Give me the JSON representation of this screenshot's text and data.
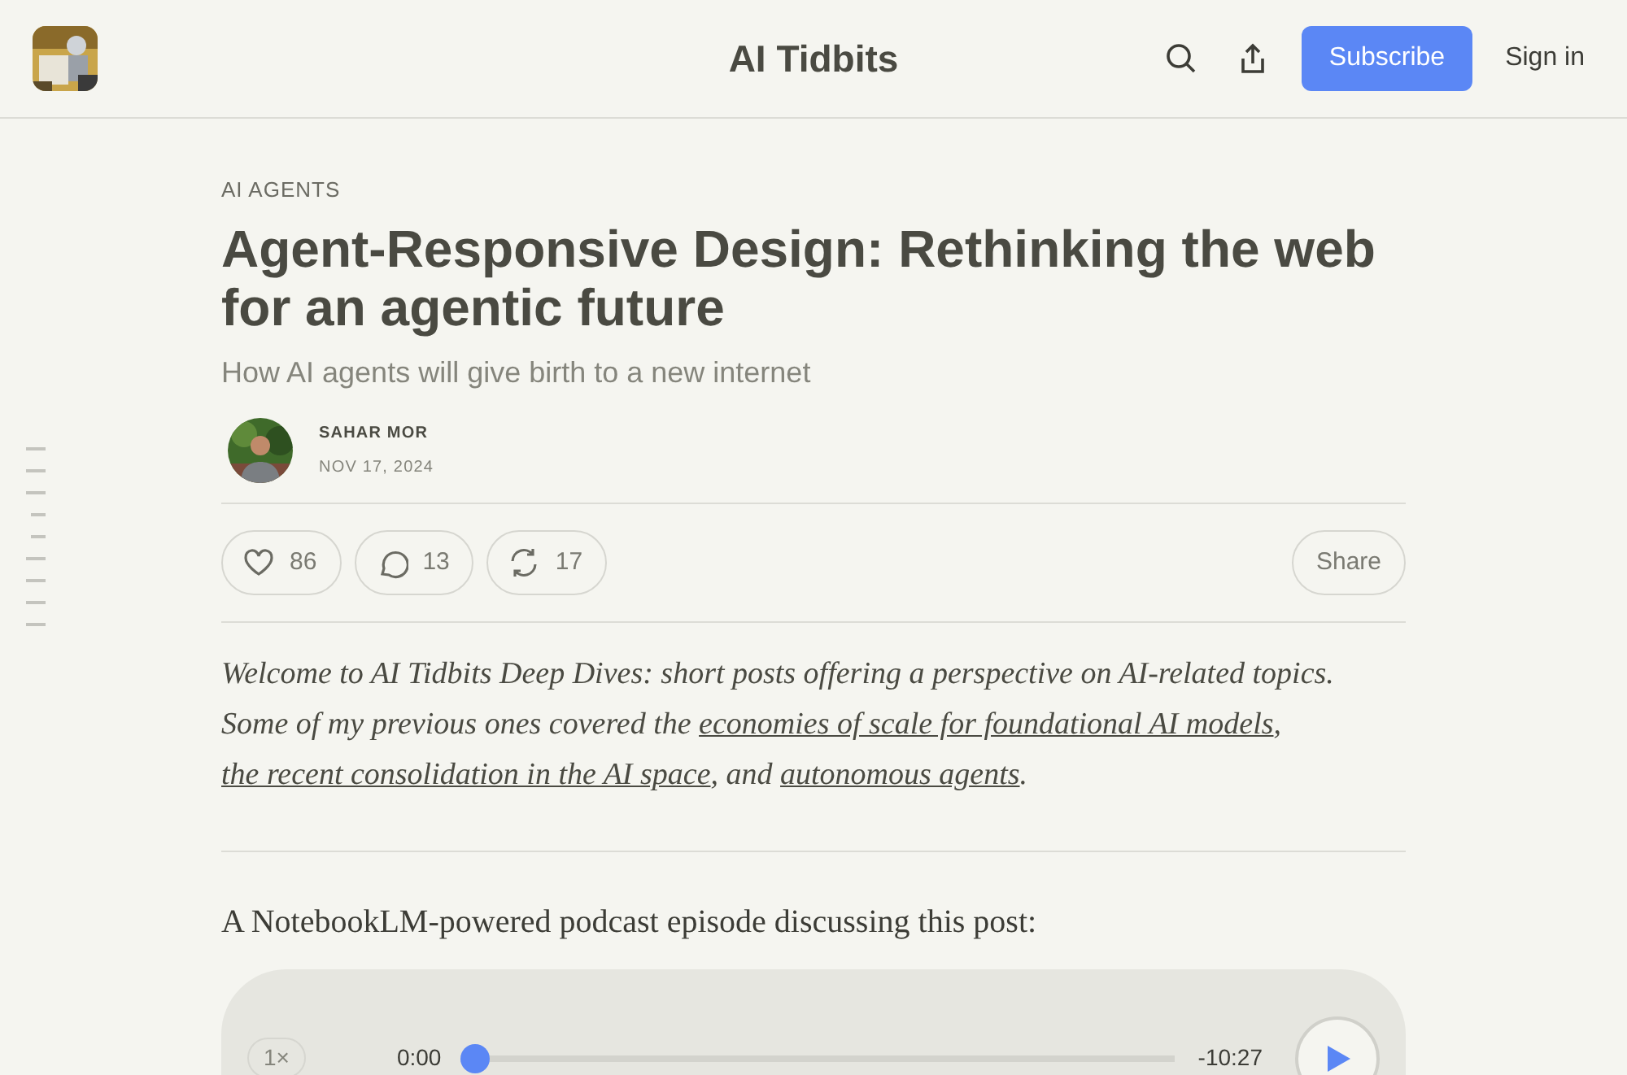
{
  "header": {
    "title": "AI Tidbits",
    "subscribe": "Subscribe",
    "sign_in": "Sign in"
  },
  "post": {
    "category": "AI AGENTS",
    "title": "Agent-Responsive Design: Rethinking the web for an agentic future",
    "subtitle": "How AI agents will give birth to a new internet",
    "author": "SAHAR MOR",
    "date": "NOV 17, 2024",
    "actions": [
      {
        "kind": "like",
        "count": "86"
      },
      {
        "kind": "comment",
        "count": "13"
      },
      {
        "kind": "restack",
        "count": "17"
      }
    ],
    "share": "Share",
    "intro": [
      {
        "text": "Welcome to AI Tidbits Deep Dives: short posts offering a perspective on AI-related topics. Some of my previous ones covered the ",
        "link": false
      },
      {
        "text": "economies of scale for foundational AI models",
        "link": true
      },
      {
        "text": ", ",
        "link": false
      },
      {
        "text": "the recent consolidation in the AI space",
        "link": true
      },
      {
        "text": ", and ",
        "link": false
      },
      {
        "text": "autonomous agents",
        "link": true
      },
      {
        "text": ".",
        "link": false
      }
    ],
    "podcast_note": "A NotebookLM-powered podcast episode discussing this post:",
    "player": {
      "speed": "1×",
      "elapsed": "0:00",
      "remaining": "-10:27",
      "level": 0
    }
  }
}
